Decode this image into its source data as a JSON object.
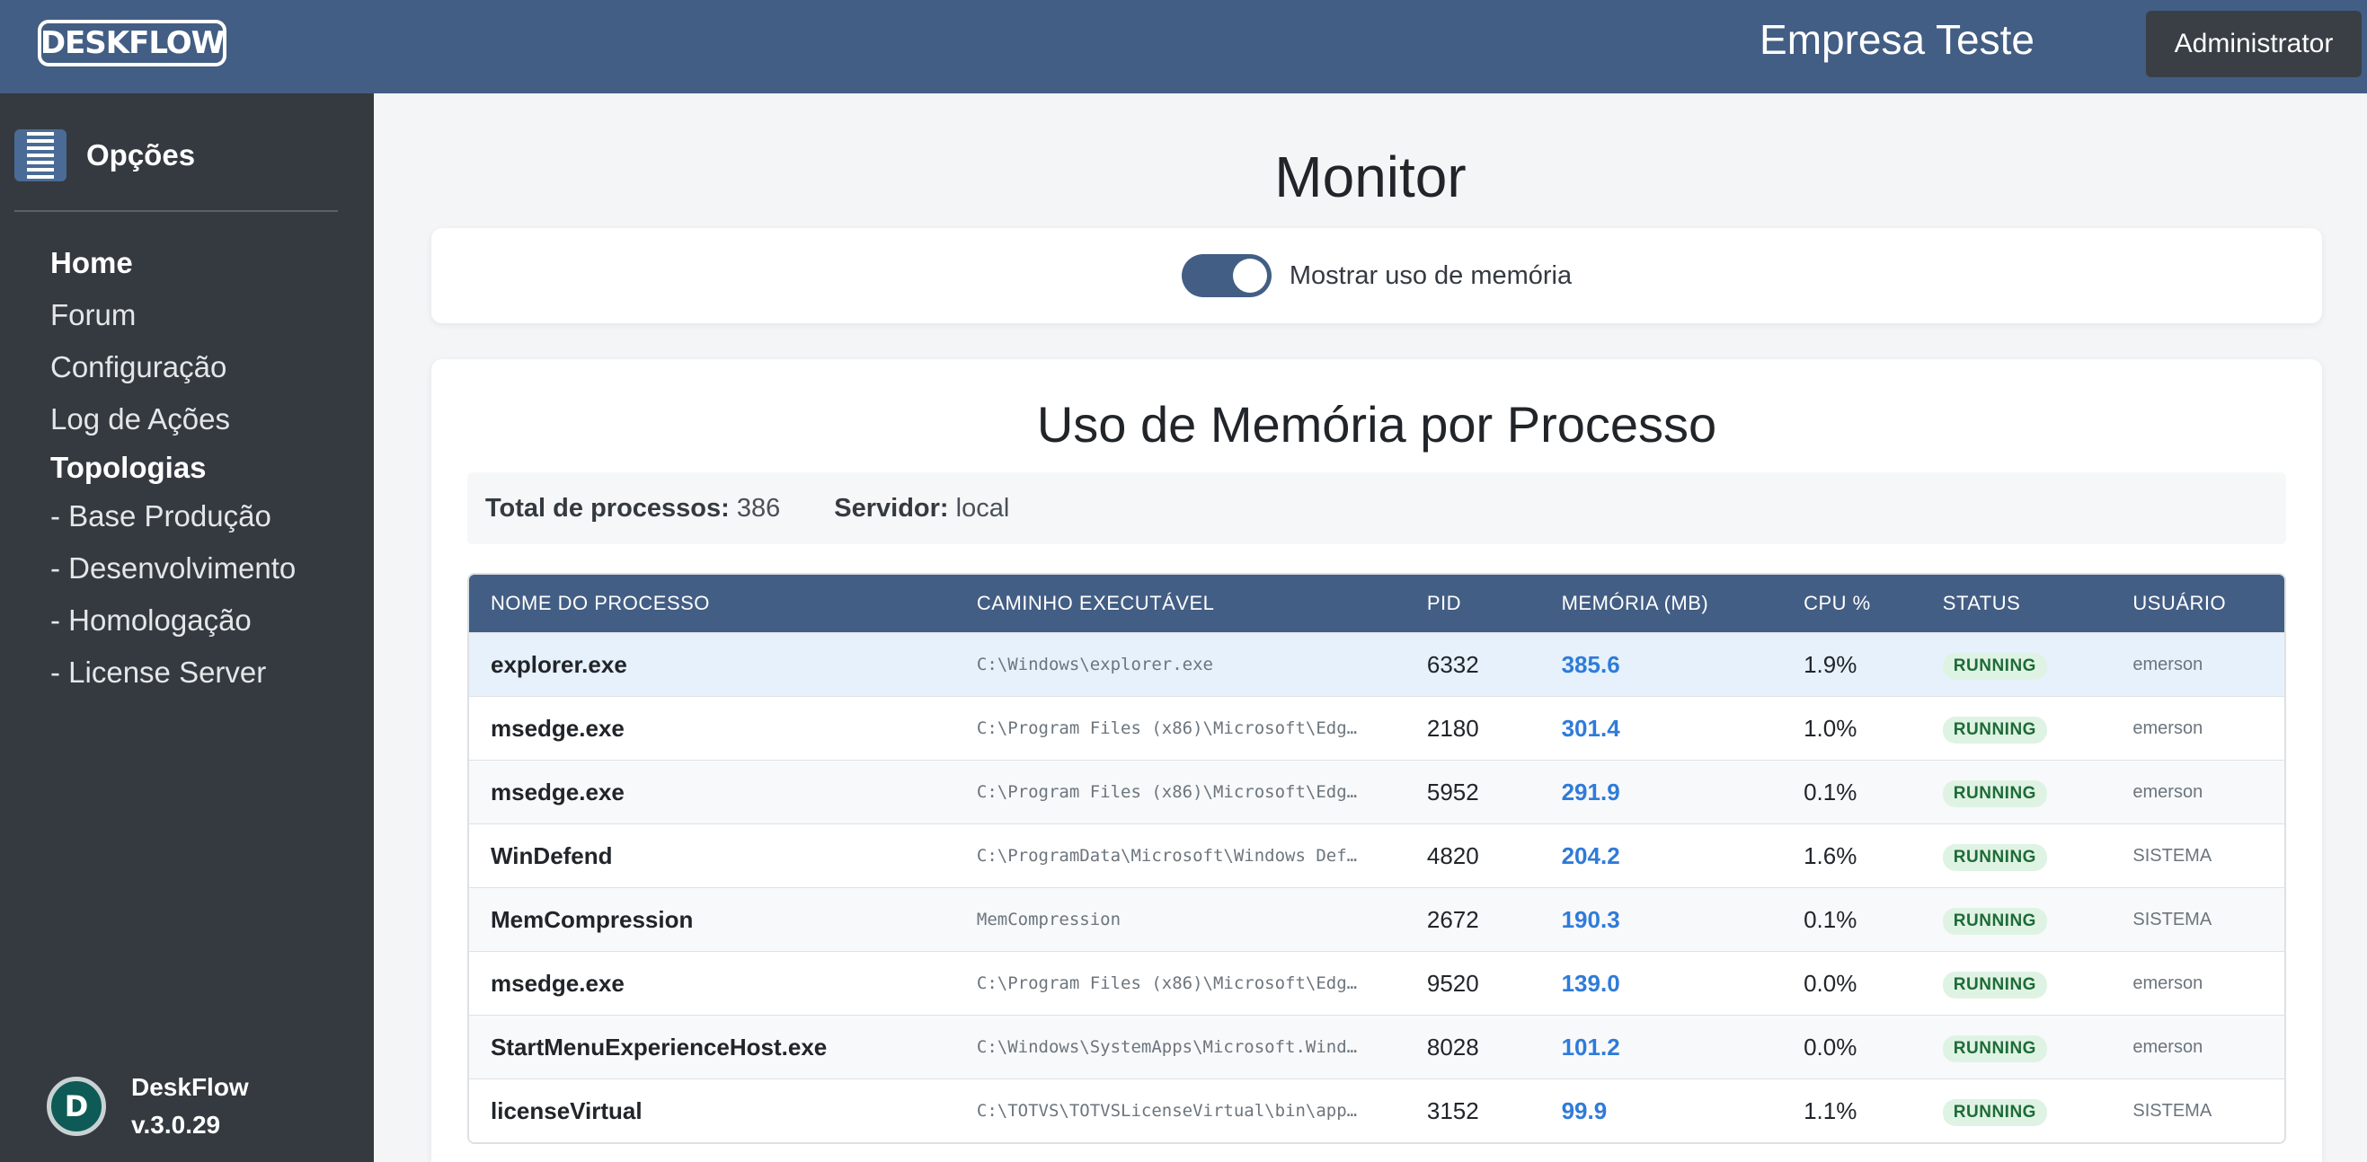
{
  "header": {
    "logo_text": "DESKFLOW",
    "company": "Empresa Teste",
    "user_button": "Administrator"
  },
  "sidebar": {
    "options_label": "Opções",
    "items": [
      "Home",
      "Forum",
      "Configuração",
      "Log de Ações"
    ],
    "group_label": "Topologias",
    "sub_items": [
      "- Base Produção",
      "- Desenvolvimento",
      "- Homologação",
      "- License Server"
    ],
    "brand_name": "DeskFlow",
    "version": "v.3.0.29"
  },
  "main": {
    "title": "Monitor",
    "toggle_label": "Mostrar uso de memória",
    "toggle_on": true,
    "mem_title": "Uso de Memória por Processo",
    "summary": {
      "total_label": "Total de processos:",
      "total_value": "386",
      "server_label": "Servidor:",
      "server_value": "local"
    },
    "table": {
      "columns": [
        "NOME DO PROCESSO",
        "CAMINHO EXECUTÁVEL",
        "PID",
        "MEMÓRIA (MB)",
        "CPU %",
        "STATUS",
        "USUÁRIO"
      ],
      "rows": [
        {
          "name": "explorer.exe",
          "path": "C:\\Windows\\explorer.exe",
          "pid": "6332",
          "mem": "385.6",
          "cpu": "1.9%",
          "status": "RUNNING",
          "user": "emerson"
        },
        {
          "name": "msedge.exe",
          "path": "C:\\Program Files (x86)\\Microsoft\\Edg…",
          "pid": "2180",
          "mem": "301.4",
          "cpu": "1.0%",
          "status": "RUNNING",
          "user": "emerson"
        },
        {
          "name": "msedge.exe",
          "path": "C:\\Program Files (x86)\\Microsoft\\Edg…",
          "pid": "5952",
          "mem": "291.9",
          "cpu": "0.1%",
          "status": "RUNNING",
          "user": "emerson"
        },
        {
          "name": "WinDefend",
          "path": "C:\\ProgramData\\Microsoft\\Windows Def…",
          "pid": "4820",
          "mem": "204.2",
          "cpu": "1.6%",
          "status": "RUNNING",
          "user": "SISTEMA"
        },
        {
          "name": "MemCompression",
          "path": "MemCompression",
          "pid": "2672",
          "mem": "190.3",
          "cpu": "0.1%",
          "status": "RUNNING",
          "user": "SISTEMA"
        },
        {
          "name": "msedge.exe",
          "path": "C:\\Program Files (x86)\\Microsoft\\Edg…",
          "pid": "9520",
          "mem": "139.0",
          "cpu": "0.0%",
          "status": "RUNNING",
          "user": "emerson"
        },
        {
          "name": "StartMenuExperienceHost.exe",
          "path": "C:\\Windows\\SystemApps\\Microsoft.Wind…",
          "pid": "8028",
          "mem": "101.2",
          "cpu": "0.0%",
          "status": "RUNNING",
          "user": "emerson"
        },
        {
          "name": "licenseVirtual",
          "path": "C:\\TOTVS\\TOTVSLicenseVirtual\\bin\\app…",
          "pid": "3152",
          "mem": "99.9",
          "cpu": "1.1%",
          "status": "RUNNING",
          "user": "SISTEMA"
        }
      ]
    }
  }
}
